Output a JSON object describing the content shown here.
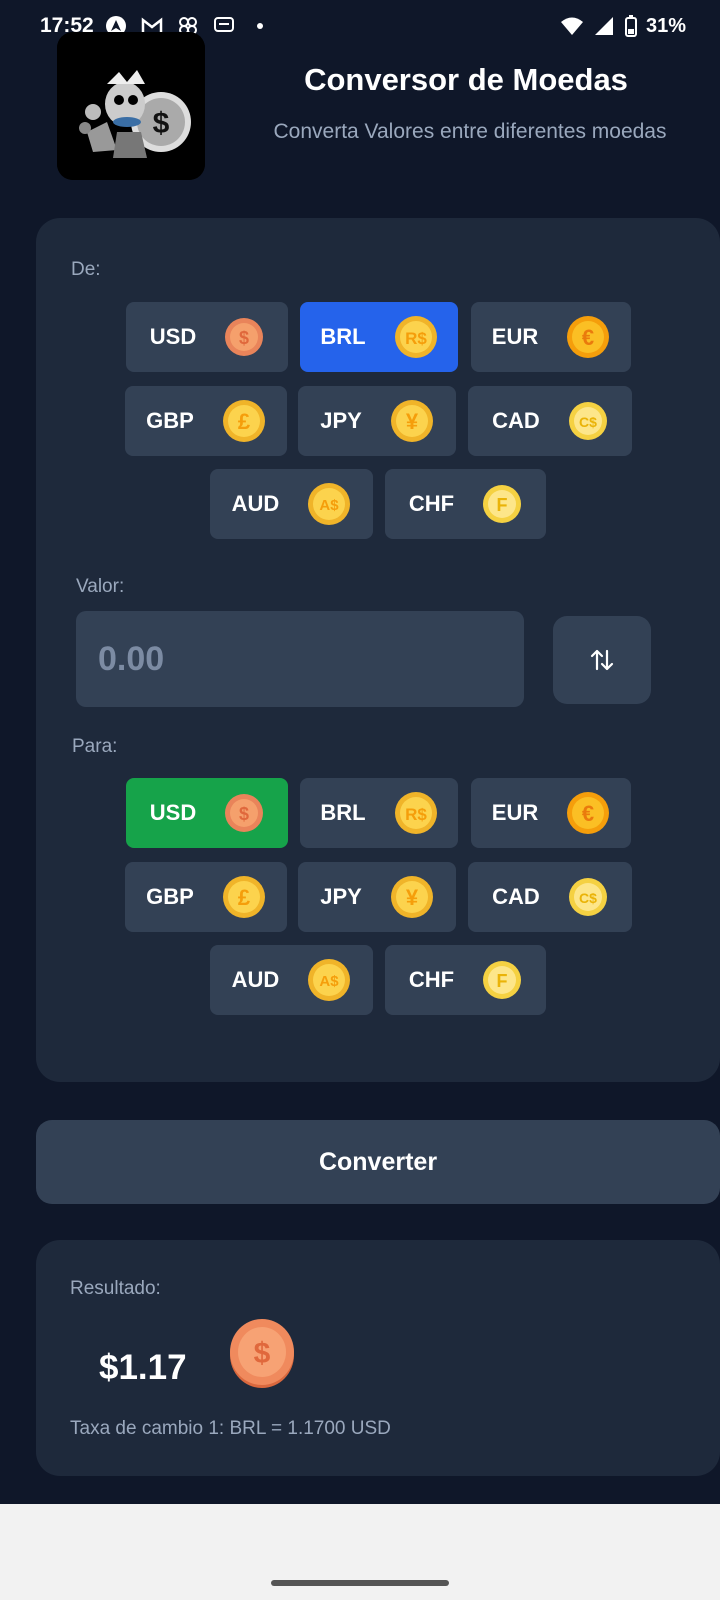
{
  "status_bar": {
    "time": "17:52",
    "battery": "31%",
    "icons_left": [
      "android-auto-icon",
      "gmail-icon",
      "pinwheel-icon",
      "message-icon",
      "dot-icon"
    ],
    "icons_right": [
      "wifi-icon",
      "signal-icon",
      "battery-icon"
    ]
  },
  "header": {
    "title": "Conversor de Moedas",
    "subtitle": "Converta Valores entre diferentes moedas"
  },
  "from": {
    "label": "De:",
    "selected": "BRL",
    "currencies": [
      {
        "code": "USD",
        "coin": "dollar-coin-icon"
      },
      {
        "code": "BRL",
        "coin": "real-coin-icon"
      },
      {
        "code": "EUR",
        "coin": "euro-coin-icon"
      },
      {
        "code": "GBP",
        "coin": "pound-coin-icon"
      },
      {
        "code": "JPY",
        "coin": "yen-coin-icon"
      },
      {
        "code": "CAD",
        "coin": "cad-coin-icon"
      },
      {
        "code": "AUD",
        "coin": "aud-coin-icon"
      },
      {
        "code": "CHF",
        "coin": "franc-coin-icon"
      }
    ]
  },
  "amount": {
    "label": "Valor:",
    "value": "",
    "placeholder": "0.00"
  },
  "to": {
    "label": "Para:",
    "selected": "USD",
    "currencies": [
      {
        "code": "USD",
        "coin": "dollar-coin-icon"
      },
      {
        "code": "BRL",
        "coin": "real-coin-icon"
      },
      {
        "code": "EUR",
        "coin": "euro-coin-icon"
      },
      {
        "code": "GBP",
        "coin": "pound-coin-icon"
      },
      {
        "code": "JPY",
        "coin": "yen-coin-icon"
      },
      {
        "code": "CAD",
        "coin": "cad-coin-icon"
      },
      {
        "code": "AUD",
        "coin": "aud-coin-icon"
      },
      {
        "code": "CHF",
        "coin": "franc-coin-icon"
      }
    ]
  },
  "convert_button": "Converter",
  "result": {
    "label": "Resultado:",
    "value": "$1.17",
    "coin": "dollar-coin-icon",
    "rate": "Taxa de cambio 1: BRL = 1.1700 USD"
  },
  "colors": {
    "background": "#0f1729",
    "card": "#1e293b",
    "button": "#334155",
    "from_selected": "#2563eb",
    "to_selected": "#16a34a",
    "muted_text": "#9aa8bd"
  }
}
